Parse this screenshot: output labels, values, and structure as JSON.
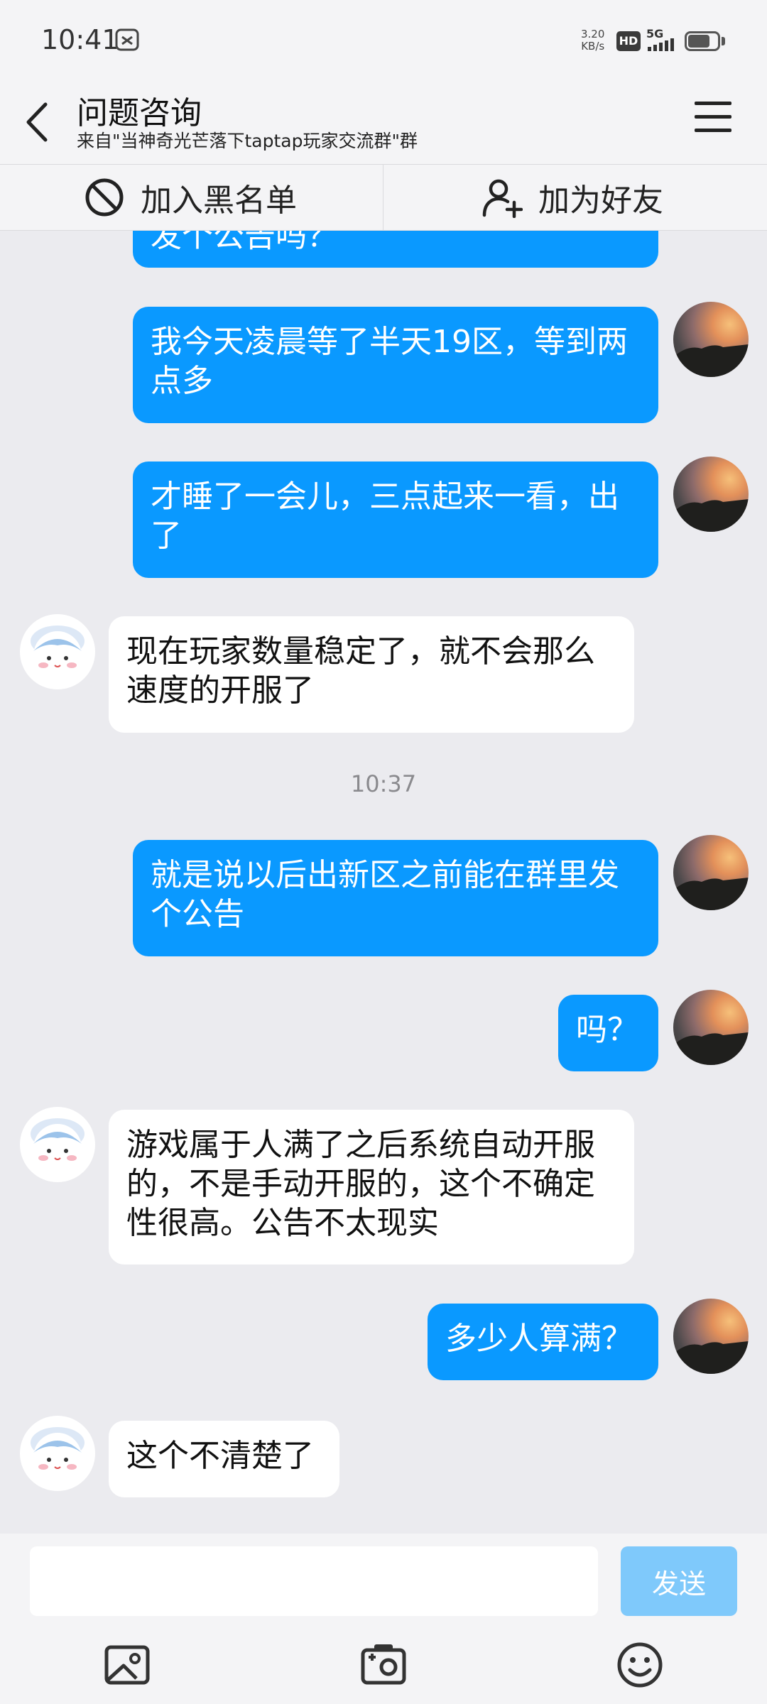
{
  "status_bar": {
    "time": "10:41",
    "net_speed_value": "3.20",
    "net_speed_unit": "KB/s",
    "hd": "HD",
    "network": "5G"
  },
  "header": {
    "title": "问题咨询",
    "subtitle": "来自\"当神奇光芒落下taptap玩家交流群\"群"
  },
  "actions": {
    "blacklist_label": "加入黑名单",
    "add_friend_label": "加为好友"
  },
  "messages": {
    "m0": "发个公告吗？",
    "m1": "我今天凌晨等了半天19区，等到两点多",
    "m2": "才睡了一会儿，三点起来一看，出了",
    "m3": "现在玩家数量稳定了，就不会那么速度的开服了",
    "timestamp": "10:37",
    "m4": "就是说以后出新区之前能在群里发个公告",
    "m5": "吗？",
    "m6": "游戏属于人满了之后系统自动开服的，不是手动开服的，这个不确定性很高。公告不太现实",
    "m7": "多少人算满？",
    "m8": "这个不清楚了"
  },
  "input": {
    "value": "",
    "send_label": "发送"
  },
  "colors": {
    "outgoing_bubble": "#0A99FF",
    "incoming_bubble": "#FFFFFF",
    "send_button": "#7FC9FB",
    "background": "#EBEBEF"
  },
  "icons": [
    "back-arrow-icon",
    "menu-icon",
    "block-icon",
    "add-user-icon",
    "image-icon",
    "camera-icon",
    "emoji-icon"
  ]
}
